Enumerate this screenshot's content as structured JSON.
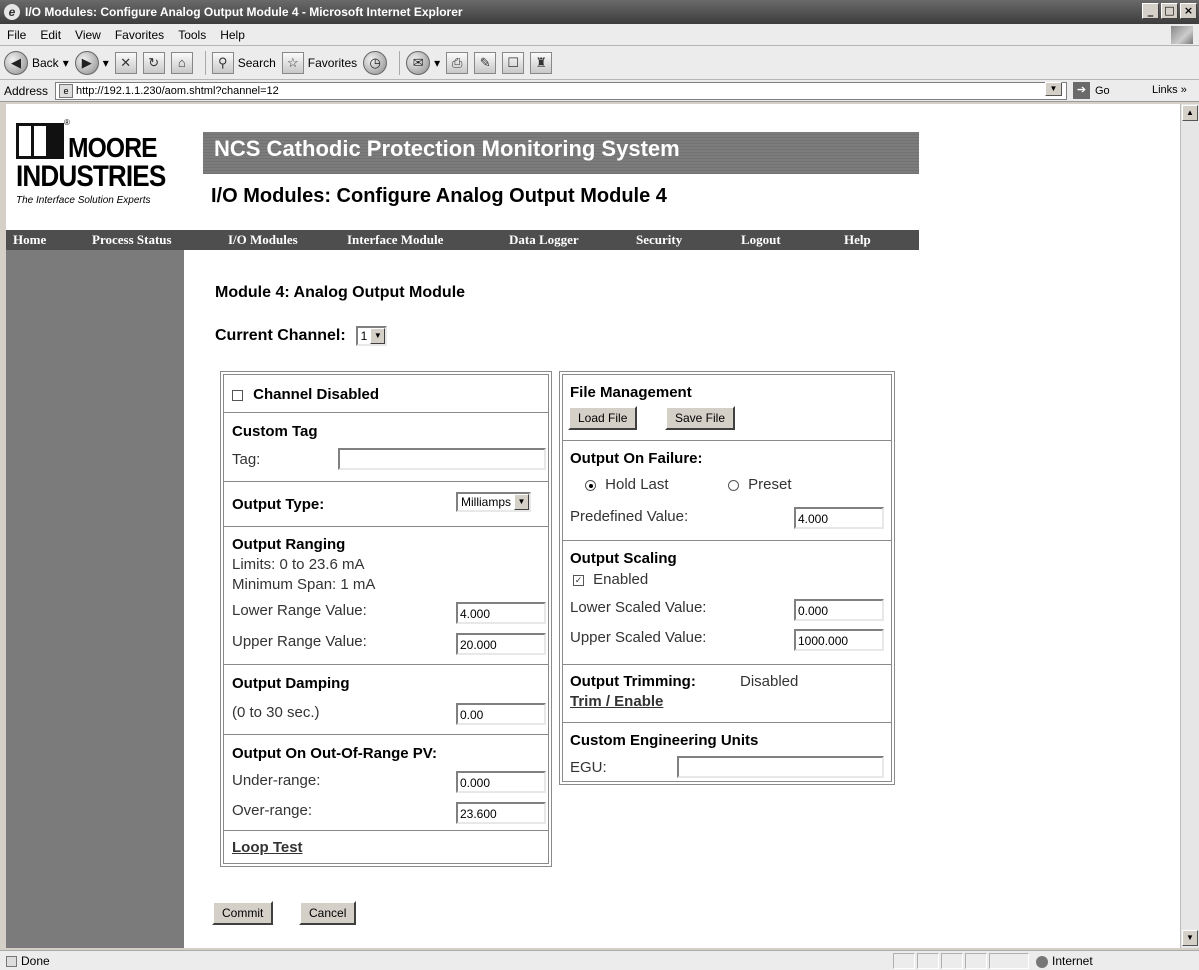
{
  "window": {
    "title": "I/O Modules: Configure Analog Output Module 4 - Microsoft Internet Explorer",
    "controls": {
      "minimize": "_",
      "maximize": "□",
      "close": "×"
    }
  },
  "menu": [
    "File",
    "Edit",
    "View",
    "Favorites",
    "Tools",
    "Help"
  ],
  "toolbar": {
    "back": "Back",
    "search": "Search",
    "favorites": "Favorites"
  },
  "address": {
    "label": "Address",
    "url": "http://192.1.1.230/aom.shtml?channel=12",
    "go": "Go",
    "links": "Links"
  },
  "logo": {
    "line1": "MOORE",
    "line2": "INDUSTRIES",
    "tagline": "The Interface Solution Experts",
    "reg": "®"
  },
  "header": {
    "system_title": "NCS Cathodic Protection Monitoring System",
    "page_title": "I/O Modules: Configure Analog Output Module 4"
  },
  "nav": [
    "Home",
    "Process Status",
    "I/O Modules",
    "Interface Module",
    "Data Logger",
    "Security",
    "Logout",
    "Help"
  ],
  "module_heading": "Module 4: Analog Output Module",
  "current_channel": {
    "label": "Current Channel:",
    "value": "1"
  },
  "left": {
    "channel_disabled": {
      "label": "Channel Disabled",
      "checked": false
    },
    "custom_tag": {
      "heading": "Custom Tag",
      "label": "Tag:",
      "value": ""
    },
    "output_type": {
      "label": "Output Type:",
      "value": "Milliamps"
    },
    "output_ranging": {
      "heading": "Output Ranging",
      "limits": "Limits: 0 to 23.6 mA",
      "min_span": "Minimum Span: 1 mA",
      "lower_label": "Lower Range Value:",
      "lower_value": "4.000",
      "upper_label": "Upper Range Value:",
      "upper_value": "20.000"
    },
    "output_damping": {
      "heading": "Output Damping",
      "label": "(0 to 30 sec.)",
      "value": "0.00"
    },
    "out_of_range": {
      "heading": "Output On Out-Of-Range PV:",
      "under_label": "Under-range:",
      "under_value": "0.000",
      "over_label": "Over-range:",
      "over_value": "23.600"
    },
    "loop_test": "Loop Test"
  },
  "right": {
    "file_management": {
      "heading": "File Management",
      "load": "Load File",
      "save": "Save File"
    },
    "output_on_failure": {
      "heading": "Output On Failure:",
      "hold_last": "Hold Last",
      "preset": "Preset",
      "selected": "hold_last",
      "predefined_label": "Predefined Value:",
      "predefined_value": "4.000"
    },
    "output_scaling": {
      "heading": "Output Scaling",
      "enabled_label": "Enabled",
      "enabled": true,
      "lower_label": "Lower Scaled Value:",
      "lower_value": "0.000",
      "upper_label": "Upper Scaled Value:",
      "upper_value": "1000.000"
    },
    "output_trimming": {
      "heading": "Output Trimming:",
      "status": "Disabled",
      "link": "Trim / Enable"
    },
    "custom_egu": {
      "heading": "Custom Engineering Units",
      "label": "EGU:",
      "value": ""
    }
  },
  "actions": {
    "commit": "Commit",
    "cancel": "Cancel"
  },
  "status": {
    "left": "Done",
    "zone": "Internet"
  }
}
